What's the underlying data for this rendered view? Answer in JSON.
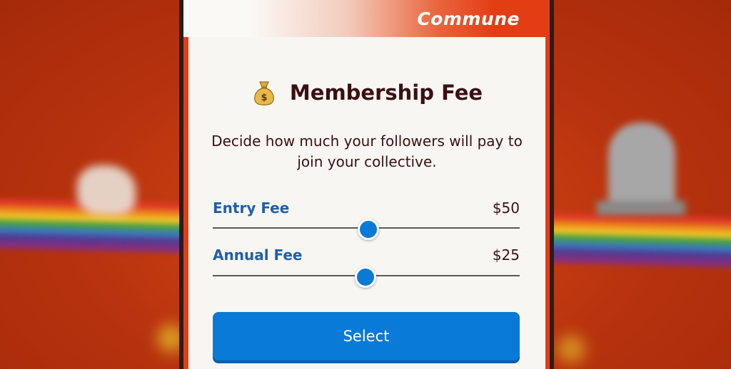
{
  "header": {
    "title": "Commune"
  },
  "dialog": {
    "title": "Membership Fee",
    "icon": "money-bag-icon",
    "description": "Decide how much your followers will pay to join your collective."
  },
  "fees": [
    {
      "label": "Entry Fee",
      "value": "$50",
      "slider_fraction": 0.5
    },
    {
      "label": "Annual Fee",
      "value": "$25",
      "slider_fraction": 0.49
    }
  ],
  "actions": {
    "select_label": "Select"
  },
  "colors": {
    "accent": "#0a7ad8",
    "header_red": "#e33d14",
    "title_text": "#3b0f12",
    "label_blue": "#1f5fa8"
  }
}
